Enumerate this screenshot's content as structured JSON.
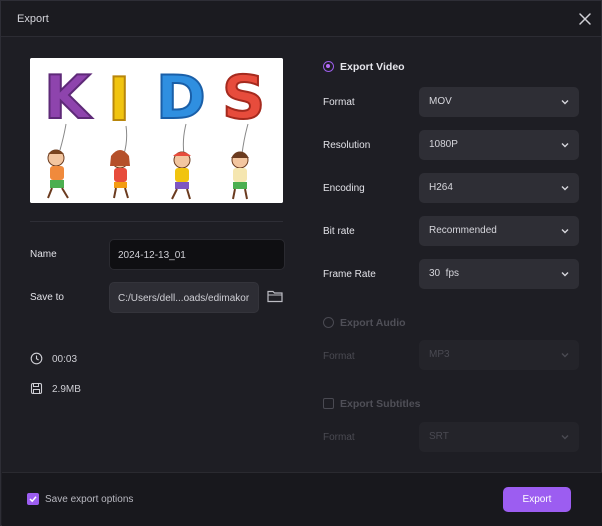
{
  "window": {
    "title": "Export"
  },
  "preview": {
    "thumbnail_text": "KIDS",
    "letter_colors": [
      "#8e44ad",
      "#f1c40f",
      "#2f8fe0",
      "#e74c3c"
    ]
  },
  "file": {
    "name_label": "Name",
    "name_value": "2024-12-13_01",
    "save_label": "Save to",
    "save_path": "C:/Users/dell...oads/edimakor"
  },
  "info": {
    "duration": "00:03",
    "size": "2.9MB"
  },
  "video": {
    "title": "Export Video",
    "format_label": "Format",
    "format_value": "MOV",
    "resolution_label": "Resolution",
    "resolution_value": "1080P",
    "encoding_label": "Encoding",
    "encoding_value": "H264",
    "bitrate_label": "Bit rate",
    "bitrate_value": "Recommended",
    "framerate_label": "Frame Rate",
    "framerate_value": "30  fps"
  },
  "audio": {
    "title": "Export Audio",
    "format_label": "Format",
    "format_value": "MP3"
  },
  "subtitles": {
    "title": "Export Subtitles",
    "format_label": "Format",
    "format_value": "SRT"
  },
  "footer": {
    "save_options_label": "Save export options",
    "export_label": "Export"
  },
  "colors": {
    "accent": "#9c5df1",
    "background": "#1e1e24"
  }
}
